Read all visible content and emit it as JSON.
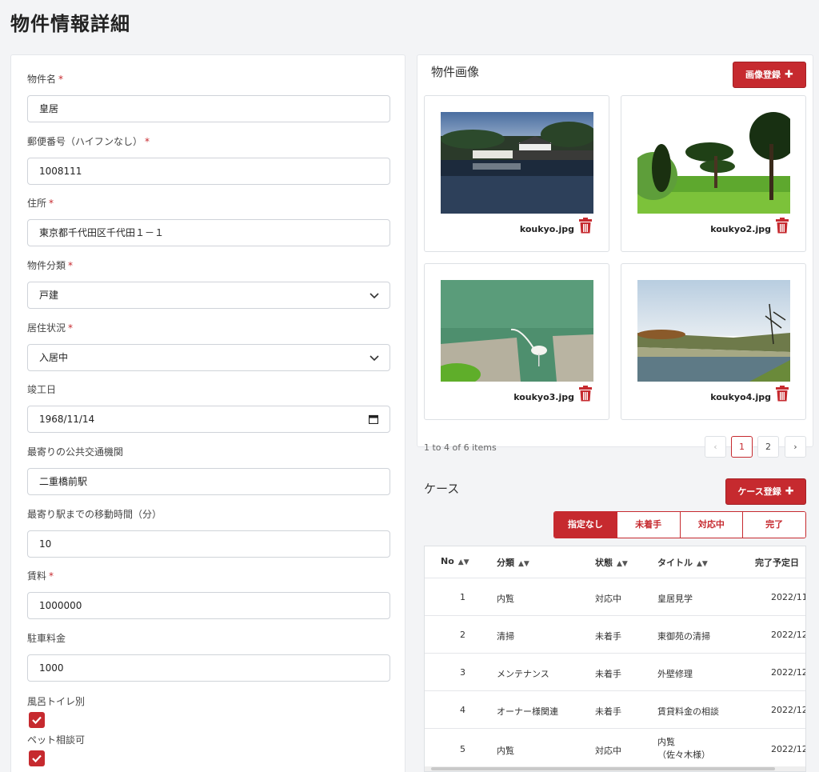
{
  "page": {
    "title": "物件情報詳細"
  },
  "form": {
    "name": {
      "label": "物件名",
      "required": true,
      "value": "皇居"
    },
    "zip": {
      "label": "郵便番号（ハイフンなし）",
      "required": true,
      "value": "1008111"
    },
    "address": {
      "label": "住所",
      "required": true,
      "value": "東京都千代田区千代田１－１"
    },
    "category": {
      "label": "物件分類",
      "required": true,
      "value": "戸建"
    },
    "residence": {
      "label": "居住状況",
      "required": true,
      "value": "入居中"
    },
    "built": {
      "label": "竣工日",
      "value": "1968/11/14"
    },
    "transit": {
      "label": "最寄りの公共交通機関",
      "value": "二重橋前駅"
    },
    "travel_time": {
      "label": "最寄り駅までの移動時間（分）",
      "value": "10"
    },
    "rent": {
      "label": "賃料",
      "required": true,
      "value": "1000000"
    },
    "parking": {
      "label": "駐車料金",
      "value": "1000"
    },
    "bath_separate": {
      "label": "風呂トイレ別",
      "checked": true
    },
    "pets": {
      "label": "ペット相談可",
      "checked": true
    },
    "required_mark": "*"
  },
  "images": {
    "title": "物件画像",
    "register_label": "画像登録",
    "items": [
      {
        "filename": "koukyo.jpg"
      },
      {
        "filename": "koukyo2.jpg"
      },
      {
        "filename": "koukyo3.jpg"
      },
      {
        "filename": "koukyo4.jpg"
      }
    ],
    "pager_info": "1 to 4 of 6 items",
    "pages": [
      "‹",
      "1",
      "2",
      "›"
    ]
  },
  "cases": {
    "title": "ケース",
    "register_label": "ケース登録",
    "filters": [
      "指定なし",
      "未着手",
      "対応中",
      "完了"
    ],
    "active_filter": "指定なし",
    "columns": [
      "No",
      "分類",
      "状態",
      "タイトル",
      "完了予定日"
    ],
    "rows": [
      {
        "no": "1",
        "category": "内覧",
        "status": "対応中",
        "title": "皇居見学",
        "title2": "",
        "due": "2022/11,"
      },
      {
        "no": "2",
        "category": "清掃",
        "status": "未着手",
        "title": "東御苑の清掃",
        "title2": "",
        "due": "2022/12,"
      },
      {
        "no": "3",
        "category": "メンテナンス",
        "status": "未着手",
        "title": "外壁修理",
        "title2": "",
        "due": "2022/12,"
      },
      {
        "no": "4",
        "category": "オーナー様関連",
        "status": "未着手",
        "title": "賃貸料金の相談",
        "title2": "",
        "due": "2022/12,"
      },
      {
        "no": "5",
        "category": "内覧",
        "status": "対応中",
        "title": "内覧",
        "title2": "（佐々木様）",
        "due": "2022/12,"
      }
    ]
  },
  "colors": {
    "accent": "#c62a2f",
    "background": "#f3f4f6"
  },
  "icons": {
    "trash": "trash-icon",
    "check": "check-icon",
    "chevron": "chevron-down-icon",
    "calendar": "calendar-icon",
    "plus": "plus-icon"
  }
}
